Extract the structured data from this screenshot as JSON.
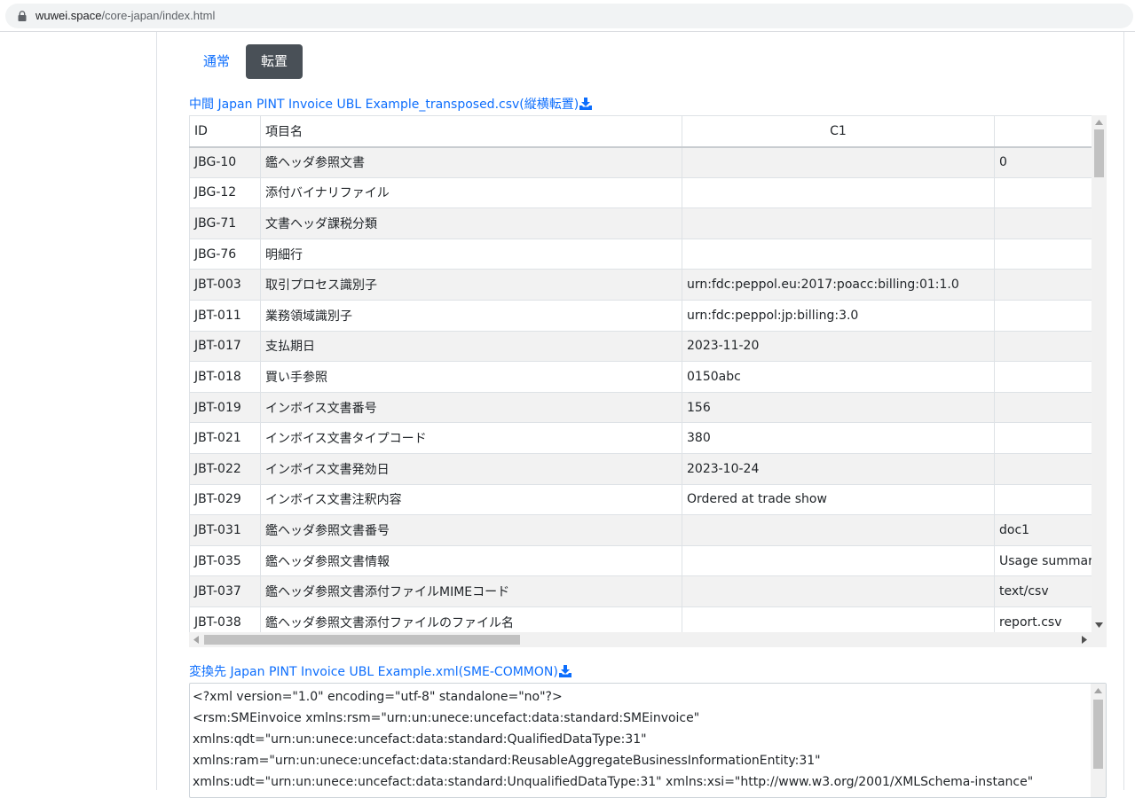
{
  "browser": {
    "url_host": "wuwei.space",
    "url_path": "/core-japan/index.html"
  },
  "tabs": {
    "normal_label": "通常",
    "transpose_label": "転置"
  },
  "csv_link": {
    "label": "中間 Japan PINT Invoice UBL Example_transposed.csv(縦横転置)"
  },
  "table": {
    "headers": [
      "ID",
      "項目名",
      "C1",
      ""
    ],
    "rows": [
      {
        "id": "JBG-10",
        "name": "鑑ヘッダ参照文書",
        "c1": "",
        "c2": "0"
      },
      {
        "id": "JBG-12",
        "name": "添付バイナリファイル",
        "c1": "",
        "c2": ""
      },
      {
        "id": "JBG-71",
        "name": "文書ヘッダ課税分類",
        "c1": "",
        "c2": ""
      },
      {
        "id": "JBG-76",
        "name": "明細行",
        "c1": "",
        "c2": ""
      },
      {
        "id": "JBT-003",
        "name": "取引プロセス識別子",
        "c1": "urn:fdc:peppol.eu:2017:poacc:billing:01:1.0",
        "c2": ""
      },
      {
        "id": "JBT-011",
        "name": "業務領域識別子",
        "c1": "urn:fdc:peppol:jp:billing:3.0",
        "c2": ""
      },
      {
        "id": "JBT-017",
        "name": "支払期日",
        "c1": "2023-11-20",
        "c2": ""
      },
      {
        "id": "JBT-018",
        "name": "買い手参照",
        "c1": "0150abc",
        "c2": ""
      },
      {
        "id": "JBT-019",
        "name": "インボイス文書番号",
        "c1": "156",
        "c2": ""
      },
      {
        "id": "JBT-021",
        "name": "インボイス文書タイプコード",
        "c1": "380",
        "c2": ""
      },
      {
        "id": "JBT-022",
        "name": "インボイス文書発効日",
        "c1": "2023-10-24",
        "c2": ""
      },
      {
        "id": "JBT-029",
        "name": "インボイス文書注釈内容",
        "c1": "Ordered at trade show",
        "c2": ""
      },
      {
        "id": "JBT-031",
        "name": "鑑ヘッダ参照文書番号",
        "c1": "",
        "c2": "doc1"
      },
      {
        "id": "JBT-035",
        "name": "鑑ヘッダ参照文書情報",
        "c1": "",
        "c2": "Usage summar"
      },
      {
        "id": "JBT-037",
        "name": "鑑ヘッダ参照文書添付ファイルMIMEコード",
        "c1": "",
        "c2": "text/csv"
      },
      {
        "id": "JBT-038",
        "name": "鑑ヘッダ参照文書添付ファイルのファイル名",
        "c1": "",
        "c2": "report.csv"
      }
    ]
  },
  "xml_link": {
    "label": "変換先 Japan PINT Invoice UBL Example.xml(SME-COMMON)"
  },
  "xml": {
    "lines": [
      "<?xml version=\"1.0\" encoding=\"utf-8\" standalone=\"no\"?>",
      "<rsm:SMEinvoice xmlns:rsm=\"urn:un:unece:uncefact:data:standard:SMEinvoice\"",
      "xmlns:qdt=\"urn:un:unece:uncefact:data:standard:QualifiedDataType:31\"",
      "xmlns:ram=\"urn:un:unece:uncefact:data:standard:ReusableAggregateBusinessInformationEntity:31\"",
      "xmlns:udt=\"urn:un:unece:uncefact:data:standard:UnqualifiedDataType:31\" xmlns:xsi=\"http://www.w3.org/2001/XMLSchema-instance\""
    ]
  },
  "icons": {
    "address_bar": "lock-icon",
    "download": "download-icon",
    "scroll_up": "arrow-up-icon",
    "scroll_down": "arrow-down-icon",
    "scroll_left": "arrow-left-icon",
    "scroll_right": "arrow-right-icon"
  },
  "colors": {
    "link": "#0d6efd",
    "active_tab_bg": "#495057",
    "stripe": "#f2f2f2"
  }
}
